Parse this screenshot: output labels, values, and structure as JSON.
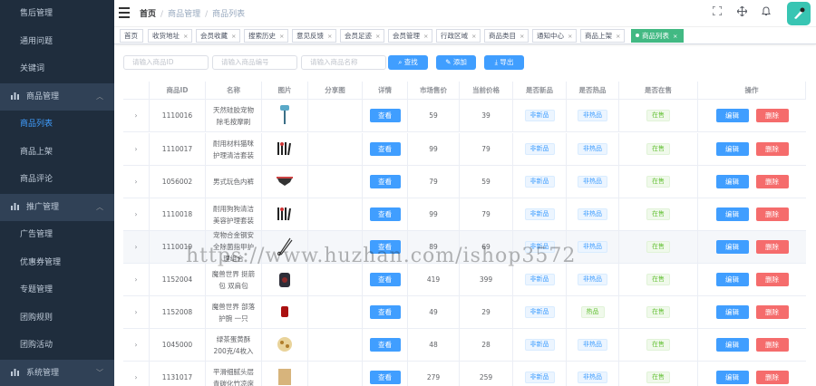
{
  "sidebar": {
    "items": [
      {
        "type": "sub",
        "label": "售后管理",
        "active": false
      },
      {
        "type": "sub",
        "label": "通用问题",
        "active": false
      },
      {
        "type": "sub",
        "label": "关键词",
        "active": false
      },
      {
        "type": "group",
        "label": "商品管理",
        "icon": "bar-chart-icon",
        "caret": "︿"
      },
      {
        "type": "sub",
        "label": "商品列表",
        "active": true
      },
      {
        "type": "sub",
        "label": "商品上架",
        "active": false
      },
      {
        "type": "sub",
        "label": "商品评论",
        "active": false
      },
      {
        "type": "group",
        "label": "推广管理",
        "icon": "bar-chart-icon",
        "caret": "︿"
      },
      {
        "type": "sub",
        "label": "广告管理",
        "active": false
      },
      {
        "type": "sub",
        "label": "优惠券管理",
        "active": false
      },
      {
        "type": "sub",
        "label": "专题管理",
        "active": false
      },
      {
        "type": "sub",
        "label": "团购规则",
        "active": false
      },
      {
        "type": "sub",
        "label": "团购活动",
        "active": false
      },
      {
        "type": "group",
        "label": "系统管理",
        "icon": "bar-chart-icon",
        "caret": "﹀"
      }
    ]
  },
  "navbar": {
    "breadcrumb": [
      "首页",
      "商品管理",
      "商品列表"
    ],
    "separator": "/",
    "icons": [
      "fullscreen-icon",
      "move-icon",
      "bell-icon"
    ]
  },
  "tags": [
    {
      "label": "首页",
      "closable": false,
      "active": false
    },
    {
      "label": "收货地址",
      "closable": true,
      "active": false
    },
    {
      "label": "会员收藏",
      "closable": true,
      "active": false
    },
    {
      "label": "搜索历史",
      "closable": true,
      "active": false
    },
    {
      "label": "意见反馈",
      "closable": true,
      "active": false
    },
    {
      "label": "会员足迹",
      "closable": true,
      "active": false
    },
    {
      "label": "会员管理",
      "closable": true,
      "active": false
    },
    {
      "label": "行政区域",
      "closable": true,
      "active": false
    },
    {
      "label": "商品类目",
      "closable": true,
      "active": false
    },
    {
      "label": "通知中心",
      "closable": true,
      "active": false
    },
    {
      "label": "商品上架",
      "closable": true,
      "active": false
    },
    {
      "label": "商品列表",
      "closable": true,
      "active": true
    }
  ],
  "filters": {
    "id_placeholder": "请输入商品ID",
    "sn_placeholder": "请输入商品编号",
    "name_placeholder": "请输入商品名称",
    "search_label": "查找",
    "add_label": "添加",
    "export_label": "导出"
  },
  "table": {
    "headers": [
      "",
      "商品ID",
      "名称",
      "图片",
      "分享图",
      "详情",
      "市场售价",
      "当前价格",
      "是否新品",
      "是否热品",
      "是否在售",
      "操作"
    ],
    "view_label": "查看",
    "edit_label": "编辑",
    "delete_label": "删除",
    "rows": [
      {
        "id": "1110016",
        "name": "天然硅胶宠物除毛按摩刷",
        "image": "brush",
        "market_price": "59",
        "price": "39",
        "is_new": "非新品",
        "is_hot": "非热品",
        "on_sale": "在售"
      },
      {
        "id": "1110017",
        "name": "耐用材料猫咪护理清洁套装",
        "image": "tools",
        "market_price": "99",
        "price": "79",
        "is_new": "非新品",
        "is_hot": "非热品",
        "on_sale": "在售"
      },
      {
        "id": "1056002",
        "name": "男式玩色内裤",
        "image": "briefs",
        "market_price": "79",
        "price": "59",
        "is_new": "非新品",
        "is_hot": "非热品",
        "on_sale": "在售"
      },
      {
        "id": "1110018",
        "name": "耐用狗狗清洁美容护理套装",
        "image": "tools",
        "market_price": "99",
        "price": "79",
        "is_new": "非新品",
        "is_hot": "非热品",
        "on_sale": "在售"
      },
      {
        "id": "1110019",
        "name": "宠物合金钢安全除菌指甲护理组合",
        "image": "scissors",
        "market_price": "89",
        "price": "69",
        "is_new": "非新品",
        "is_hot": "非热品",
        "on_sale": "在售"
      },
      {
        "id": "1152004",
        "name": "魔兽世界 挺箭包 双肩包",
        "image": "backpack",
        "market_price": "419",
        "price": "399",
        "is_new": "非新品",
        "is_hot": "非热品",
        "on_sale": "在售"
      },
      {
        "id": "1152008",
        "name": "魔兽世界 部落 护腕 一只",
        "image": "wrist",
        "market_price": "49",
        "price": "29",
        "is_new": "非新品",
        "is_hot": "热品",
        "on_sale": "在售"
      },
      {
        "id": "1045000",
        "name": "绿茶蛋黄酥 200克/4枚入",
        "image": "pastry",
        "market_price": "48",
        "price": "28",
        "is_new": "非新品",
        "is_hot": "非热品",
        "on_sale": "在售"
      },
      {
        "id": "1131017",
        "name": "平滑细腻头层青碳化竹凉席",
        "image": "mat",
        "market_price": "279",
        "price": "259",
        "is_new": "非新品",
        "is_hot": "非热品",
        "on_sale": "在售"
      }
    ]
  },
  "watermark": "https://www.huzhan.com/ishop3572",
  "colors": {
    "sidebar_bg": "#304156",
    "submenu_bg": "#1f2d3d",
    "primary": "#409eff",
    "danger": "#f56c6c",
    "success": "#42b983"
  }
}
